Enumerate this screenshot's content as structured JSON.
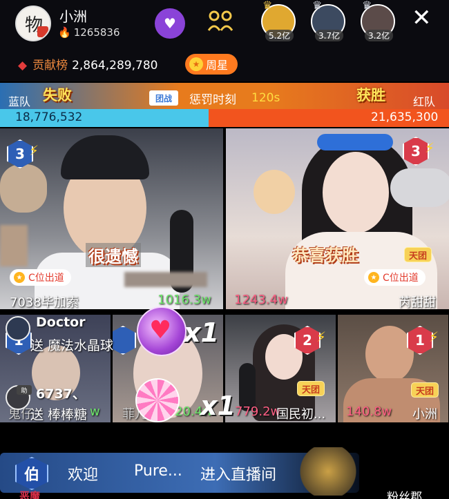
{
  "header": {
    "avatar_glyph": "物",
    "host_name": "小洲",
    "host_fans": "1265836",
    "viewers": [
      {
        "amount": "5.2亿"
      },
      {
        "amount": "3.7亿"
      },
      {
        "amount": "3.2亿"
      }
    ],
    "contrib_label": "贡献榜",
    "contrib_value": "2,864,289,780",
    "weekly_star": "周星"
  },
  "pk": {
    "blue_team": "蓝队",
    "red_team": "红队",
    "blue_result": "失败",
    "red_result": "获胜",
    "team_badge": "团战",
    "phase": "惩罚时刻",
    "timer": "120s",
    "blue_score": "18,776,532",
    "red_score": "21,635,300",
    "blue_fraction": 0.465
  },
  "streams": {
    "big_left": {
      "rank": "3",
      "overlay": "很遗憾",
      "c_label": "C位出道",
      "name": "7038毕加索",
      "score": "1016.3w"
    },
    "big_right": {
      "rank": "3",
      "overlay": "恭喜获胜",
      "c_label": "C位出道",
      "tian": "天团",
      "name": "芮甜甜",
      "score": "1243.4w"
    },
    "small": [
      {
        "rank": "1",
        "name": "鬼仔",
        "score": "w"
      },
      {
        "rank": "",
        "name": "菲儿",
        "score": "20.4w"
      },
      {
        "rank": "2",
        "tian": "天团",
        "name": "国民初...",
        "score": "779.2w"
      },
      {
        "rank": "1",
        "tian": "天团",
        "name": "小洲",
        "score": "140.8w"
      }
    ]
  },
  "gifts": [
    {
      "user": "Doctor",
      "text": "送 魔法水晶球",
      "count": "x1"
    },
    {
      "user": "6737、",
      "text": "送 棒棒糖",
      "count": "x1",
      "tag": "助"
    }
  ],
  "welcome": {
    "badge": "伯",
    "welcome": "欢迎",
    "user": "Pure...",
    "action": "进入直播间"
  },
  "bottom": {
    "left_text": "恶魔",
    "fan_club": "粉丝郡"
  },
  "colors": {
    "blue_team": "#49c7ea",
    "red_team": "#f2541e",
    "accent_orange": "#ff7a1f",
    "follow_purple": "#8a43d8"
  }
}
